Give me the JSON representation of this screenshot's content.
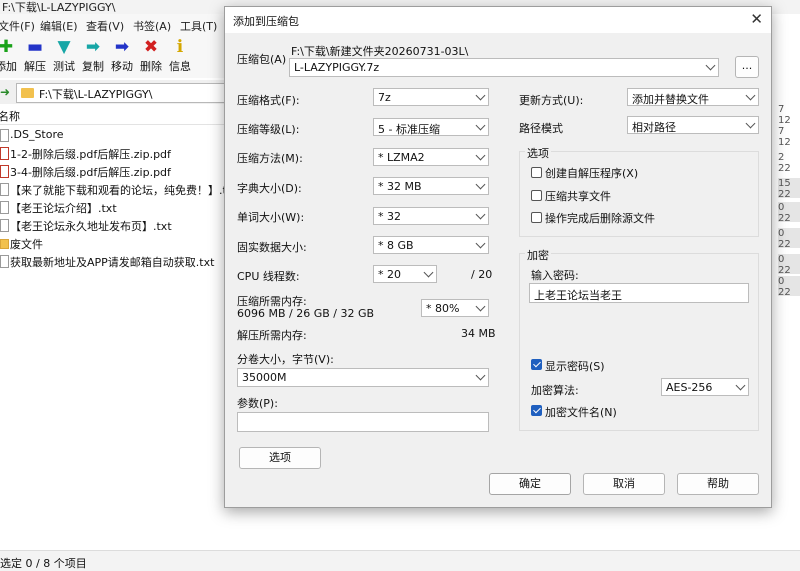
{
  "background_window": {
    "title": "F:\\下载\\L-LAZYPIGGY\\",
    "menu": [
      "文件(F)",
      "编辑(E)",
      "查看(V)",
      "书签(A)",
      "工具(T)"
    ],
    "toolbar": [
      {
        "label": "添加",
        "icon": "add-icon",
        "glyph": "✚",
        "color": "#1aa21a"
      },
      {
        "label": "解压",
        "icon": "extract-icon",
        "glyph": "▬",
        "color": "#2334c8"
      },
      {
        "label": "测试",
        "icon": "test-icon",
        "glyph": "▼",
        "color": "#17a6a6"
      },
      {
        "label": "复制",
        "icon": "copy-icon",
        "glyph": "➡",
        "color": "#17a6a6"
      },
      {
        "label": "移动",
        "icon": "move-icon",
        "glyph": "➡",
        "color": "#2334c8"
      },
      {
        "label": "删除",
        "icon": "delete-icon",
        "glyph": "✖",
        "color": "#d22020"
      },
      {
        "label": "信息",
        "icon": "info-icon",
        "glyph": "ℹ",
        "color": "#d4a700"
      }
    ],
    "address_path": "F:\\下载\\L-LAZYPIGGY\\",
    "column_name": "名称",
    "files": [
      {
        "name": ".DS_Store",
        "type": "file"
      },
      {
        "name": "1-2-删除后缀.pdf后解压.zip.pdf",
        "type": "pdf"
      },
      {
        "name": "3-4-删除后缀.pdf后解压.zip.pdf",
        "type": "pdf"
      },
      {
        "name": "【来了就能下载和观看的论坛，纯免费！】.txt",
        "type": "file"
      },
      {
        "name": "【老王论坛介绍】.txt",
        "type": "file"
      },
      {
        "name": "【老王论坛永久地址发布页】.txt",
        "type": "file"
      },
      {
        "name": "废文件",
        "type": "folder"
      },
      {
        "name": "获取最新地址及APP请发邮箱自动获取.txt",
        "type": "file"
      }
    ],
    "right_cells": [
      "7 12",
      "7 12",
      "2 22",
      "15 22",
      "0 22",
      "0 22",
      "0 22",
      "0 22"
    ],
    "status": "选定 0 / 8 个项目"
  },
  "dialog": {
    "title": "添加到压缩包",
    "archive_label": "压缩包(A)",
    "archive_dir": "F:\\下载\\新建文件夹20260731-03L\\",
    "archive_name": "L-LAZYPIGGY.7z",
    "browse_label": "...",
    "format_label": "压缩格式(F):",
    "format_value": "7z",
    "level_label": "压缩等级(L):",
    "level_value": "5 - 标准压缩",
    "method_label": "压缩方法(M):",
    "method_value": "*  LZMA2",
    "dict_label": "字典大小(D):",
    "dict_value": "*  32 MB",
    "word_label": "单词大小(W):",
    "word_value": "*  32",
    "solid_label": "固实数据大小:",
    "solid_value": "*  8 GB",
    "cpu_label": "CPU 线程数:",
    "cpu_value": "*  20",
    "cpu_total": "/ 20",
    "mem_comp_label": "压缩所需内存:",
    "mem_comp_value": "6096 MB / 26 GB / 32 GB",
    "mem_percent": "*  80%",
    "mem_decomp_label": "解压所需内存:",
    "mem_decomp_value": "34 MB",
    "split_label": "分卷大小，字节(V):",
    "split_value": "35000M",
    "params_label": "参数(P):",
    "params_value": "",
    "options_button": "选项",
    "update_label": "更新方式(U):",
    "update_value": "添加并替换文件",
    "path_label": "路径模式",
    "path_value": "相对路径",
    "options_group": "选项",
    "opt_sfx": "创建自解压程序(X)",
    "opt_shared": "压缩共享文件",
    "opt_delete": "操作完成后删除源文件",
    "encrypt_group": "加密",
    "password_label": "输入密码:",
    "password_value": "上老王论坛当老王",
    "show_password": "显示密码(S)",
    "enc_method_label": "加密算法:",
    "enc_method_value": "AES-256",
    "encrypt_names": "加密文件名(N)",
    "ok": "确定",
    "cancel": "取消",
    "help": "帮助"
  }
}
